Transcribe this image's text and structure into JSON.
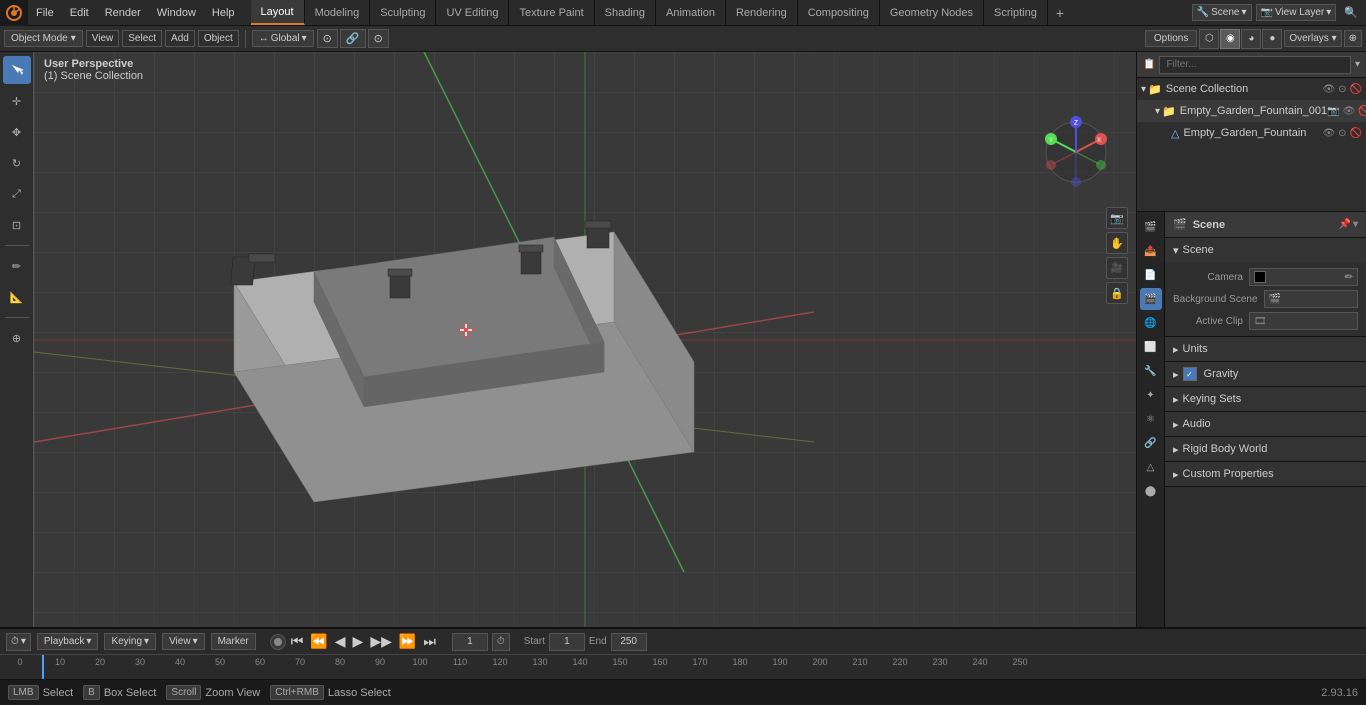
{
  "app": {
    "title": "Blender",
    "version": "2.93.16"
  },
  "menubar": {
    "items": [
      "File",
      "Edit",
      "Render",
      "Window",
      "Help"
    ],
    "scene_label": "Scene",
    "view_layer_label": "View Layer"
  },
  "workspaces": {
    "tabs": [
      "Layout",
      "Modeling",
      "Sculpting",
      "UV Editing",
      "Texture Paint",
      "Shading",
      "Animation",
      "Rendering",
      "Compositing",
      "Geometry Nodes",
      "Scripting"
    ],
    "active": "Layout"
  },
  "viewport": {
    "mode": "Object Mode",
    "perspective": "User Perspective",
    "collection": "(1) Scene Collection",
    "shading": "Solid",
    "overlays": "Overlays",
    "options_label": "Options"
  },
  "outliner": {
    "header_icon": "outliner",
    "search_placeholder": "Filter...",
    "items": [
      {
        "label": "Scene Collection",
        "icon": "collection",
        "expanded": true,
        "level": 0
      },
      {
        "label": "Empty_Garden_Fountain_001",
        "icon": "collection",
        "expanded": true,
        "level": 1
      },
      {
        "label": "Empty_Garden_Fountain",
        "icon": "mesh",
        "level": 2
      }
    ]
  },
  "properties": {
    "icon_bar": [
      "render",
      "output",
      "view_layer",
      "scene",
      "world",
      "object",
      "modifier",
      "particles",
      "physics",
      "constraints",
      "object_data",
      "material"
    ],
    "scene_label": "Scene",
    "active_icon": "scene",
    "sections": {
      "scene": {
        "label": "Scene",
        "expanded": true,
        "camera_label": "Camera",
        "camera_value": "",
        "background_scene_label": "Background Scene",
        "background_scene_value": "",
        "active_clip_label": "Active Clip",
        "active_clip_value": ""
      },
      "units": {
        "label": "Units",
        "expanded": false
      },
      "gravity": {
        "label": "Gravity",
        "expanded": true,
        "checked": true
      },
      "keying_sets": {
        "label": "Keying Sets",
        "expanded": false
      },
      "audio": {
        "label": "Audio",
        "expanded": false
      },
      "rigid_body_world": {
        "label": "Rigid Body World",
        "expanded": false
      },
      "custom_properties": {
        "label": "Custom Properties",
        "expanded": false
      }
    }
  },
  "timeline": {
    "playback_label": "Playback",
    "keying_label": "Keying",
    "view_label": "View",
    "marker_label": "Marker",
    "current_frame": "1",
    "start_label": "Start",
    "start_value": "1",
    "end_label": "End",
    "end_value": "250",
    "frame_numbers": [
      "0",
      "10",
      "20",
      "30",
      "40",
      "50",
      "60",
      "70",
      "80",
      "90",
      "100",
      "110",
      "120",
      "130",
      "140",
      "150",
      "160",
      "170",
      "180",
      "190",
      "200",
      "210",
      "220",
      "230",
      "240",
      "250"
    ]
  },
  "statusbar": {
    "select_label": "Select",
    "box_select_label": "Box Select",
    "zoom_view_label": "Zoom View",
    "lasso_select_label": "Lasso Select",
    "version": "2.93.16"
  },
  "toolbar": {
    "global_label": "Global",
    "view_label": "View",
    "select_label": "Select",
    "add_label": "Add",
    "object_label": "Object"
  }
}
